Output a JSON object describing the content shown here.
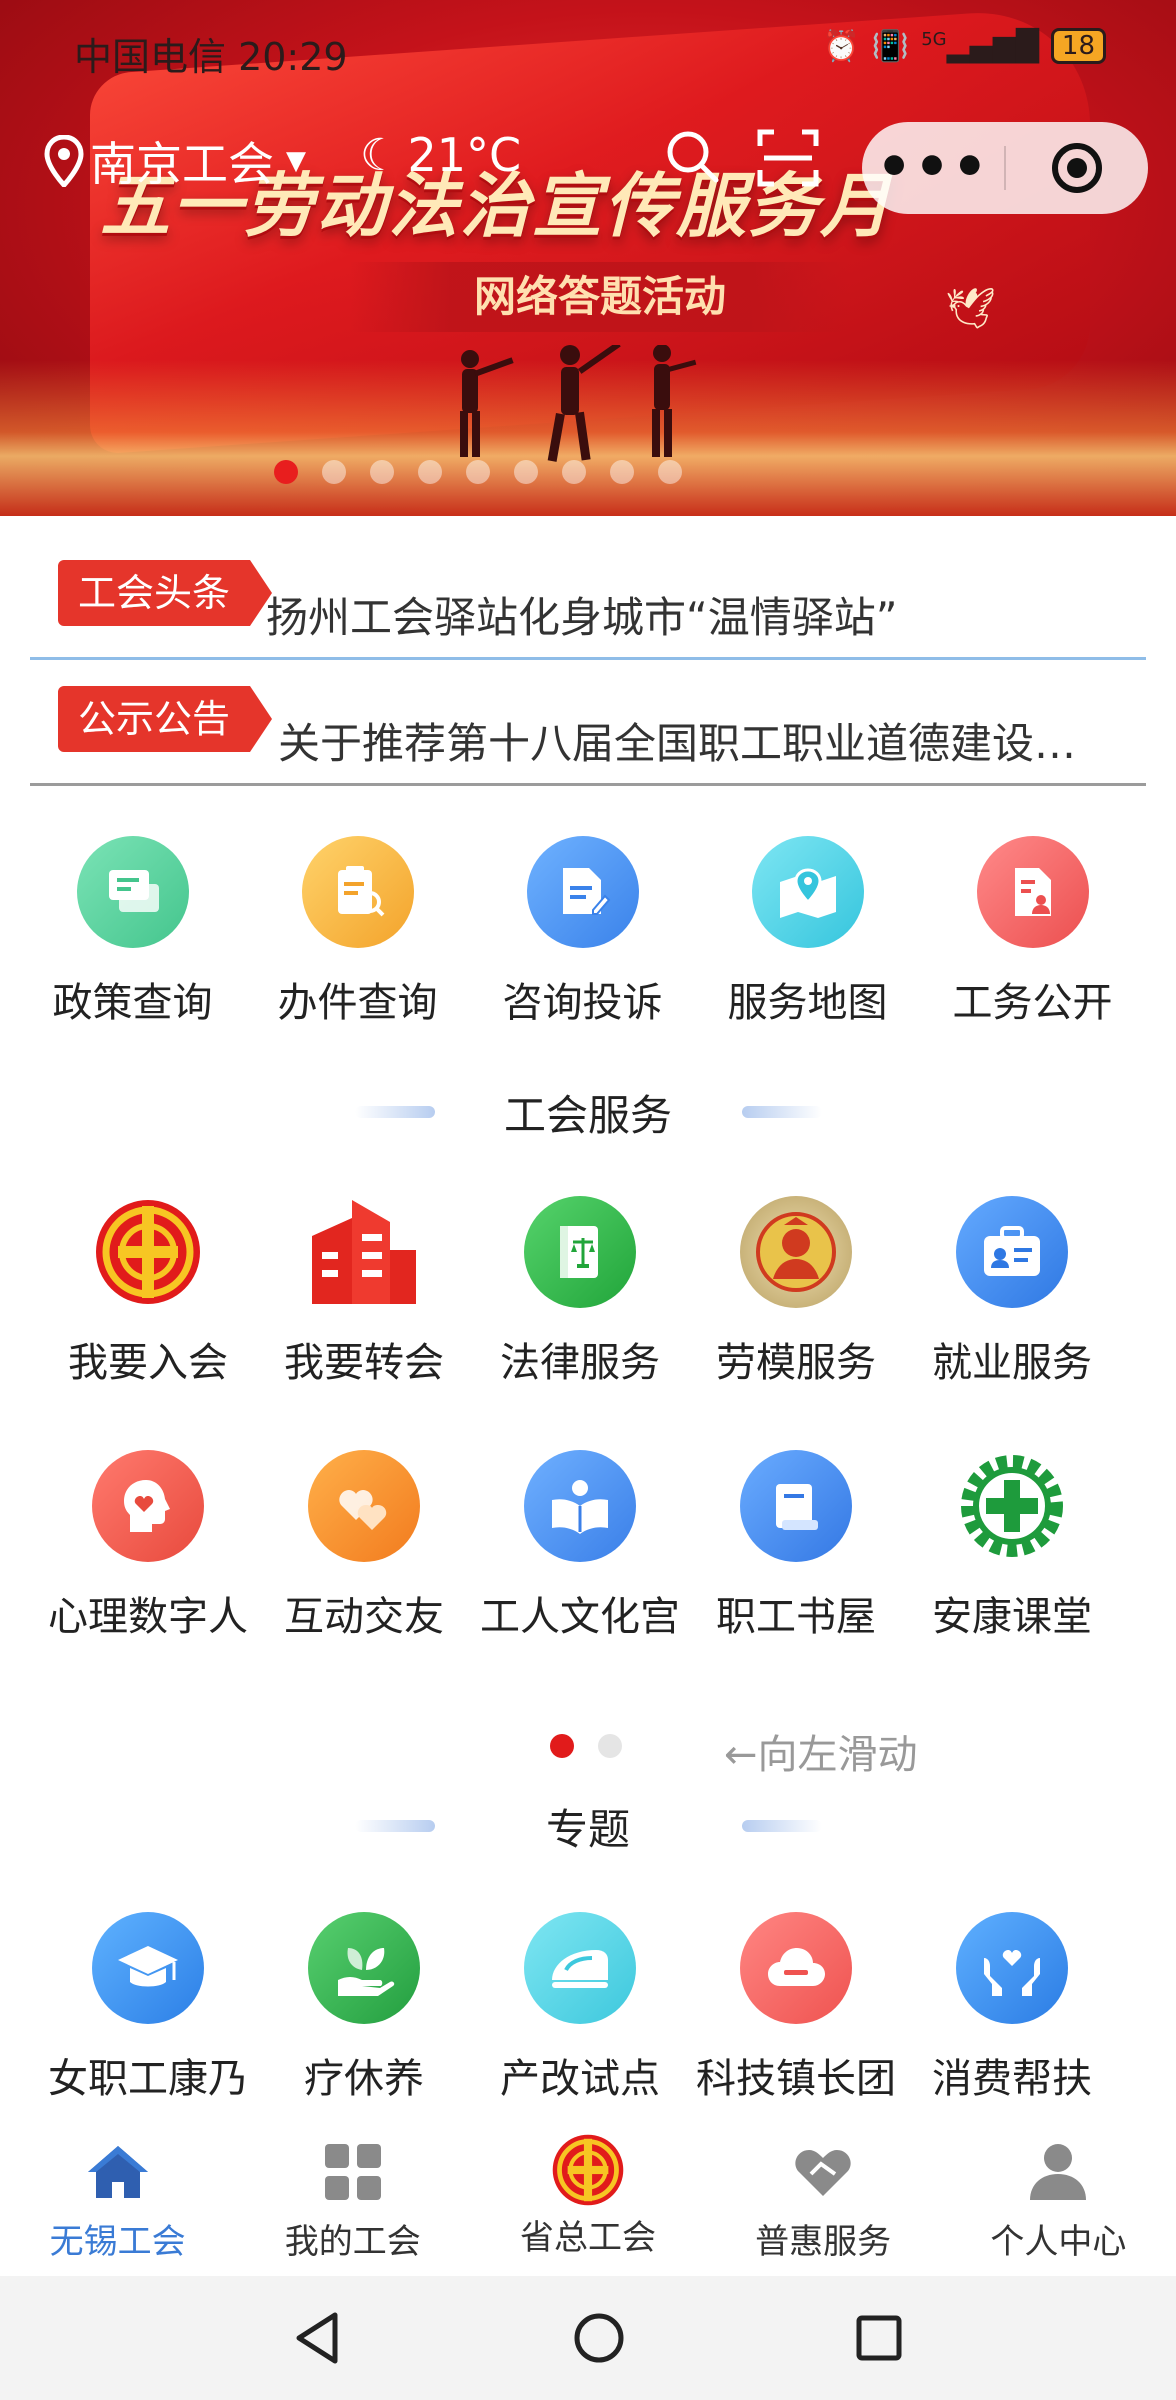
{
  "status_bar": {
    "carrier_time": "中国电信 20:29",
    "signal_text": "5G",
    "battery": "18"
  },
  "banner": {
    "headline": "五一劳动法治宣传服务月",
    "subtitle": "网络答题活动",
    "slide_count": 9,
    "active_slide": 1
  },
  "top_bar": {
    "city": "南京工会",
    "temperature": "21°C",
    "more_label": "•••"
  },
  "news": [
    {
      "tag": "工会头条",
      "text": "扬州工会驿站化身城市“温情驿站”"
    },
    {
      "tag": "公示公告",
      "text": "关于推荐第十八届全国职工职业道德建设…"
    }
  ],
  "quick_entries": [
    {
      "label": "政策查询",
      "icon": "chat-card-icon",
      "color": "#5ad3a1"
    },
    {
      "label": "办件查询",
      "icon": "clipboard-search-icon",
      "color": "#f6b73c"
    },
    {
      "label": "咨询投诉",
      "icon": "document-edit-icon",
      "color": "#4f9af0"
    },
    {
      "label": "服务地图",
      "icon": "map-pin-icon",
      "color": "#4fd3e8"
    },
    {
      "label": "工务公开",
      "icon": "file-user-icon",
      "color": "#f26464"
    }
  ],
  "sections": {
    "service_title": "工会服务",
    "topic_title": "专题"
  },
  "services_page1_row1": [
    {
      "label": "我要入会",
      "icon": "union-emblem-icon"
    },
    {
      "label": "我要转会",
      "icon": "building-icon"
    },
    {
      "label": "法律服务",
      "icon": "law-book-icon"
    },
    {
      "label": "劳模服务",
      "icon": "model-worker-medal-icon"
    },
    {
      "label": "就业服务",
      "icon": "briefcase-icon"
    }
  ],
  "services_page1_row2": [
    {
      "label": "心理数字人",
      "icon": "head-heart-icon"
    },
    {
      "label": "互动交友",
      "icon": "hearts-icon"
    },
    {
      "label": "工人文化宫",
      "icon": "open-book-person-icon"
    },
    {
      "label": "职工书屋",
      "icon": "book-icon"
    },
    {
      "label": "安康课堂",
      "icon": "green-cross-gear-icon"
    }
  ],
  "pager": {
    "pages": 2,
    "active": 1,
    "hint": "←向左滑动"
  },
  "topics": [
    {
      "label": "女职工康乃",
      "icon": "graduation-cap-icon"
    },
    {
      "label": "疗休养",
      "icon": "hand-leaf-icon"
    },
    {
      "label": "产改试点",
      "icon": "train-icon"
    },
    {
      "label": "科技镇长团",
      "icon": "cloud-icon"
    },
    {
      "label": "消费帮扶",
      "icon": "hands-heart-icon"
    }
  ],
  "tabs": [
    {
      "label": "无锡工会",
      "icon": "home-icon",
      "active": true
    },
    {
      "label": "我的工会",
      "icon": "grid-icon",
      "active": false
    },
    {
      "label": "省总工会",
      "icon": "union-emblem-icon",
      "active": false
    },
    {
      "label": "普惠服务",
      "icon": "heart-hand-icon",
      "active": false
    },
    {
      "label": "个人中心",
      "icon": "person-icon",
      "active": false
    }
  ],
  "colors": {
    "accent": "#3a7bd5",
    "news_tag": "#e5352b",
    "banner_red": "#c4121a"
  }
}
